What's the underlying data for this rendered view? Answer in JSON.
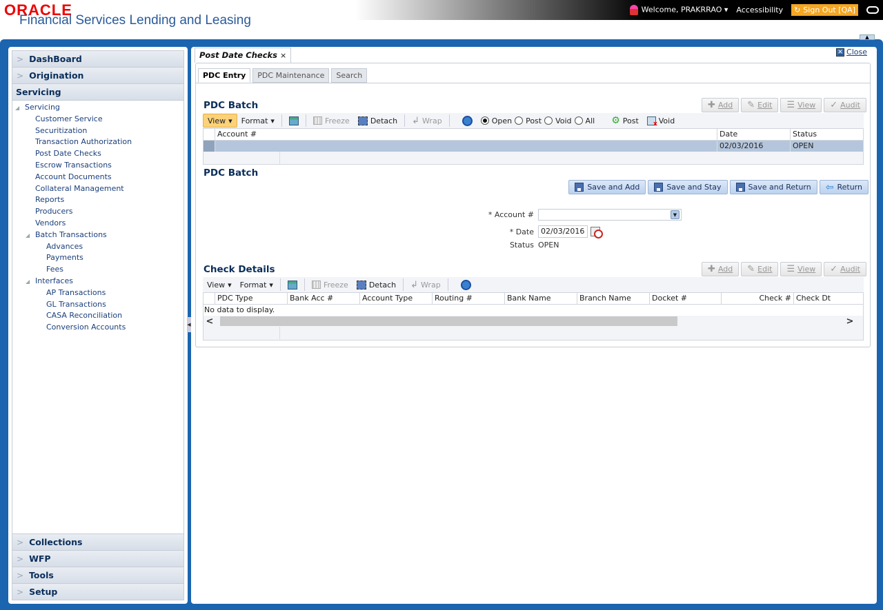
{
  "header": {
    "logo": "ORACLE",
    "app_title": "Financial Services Lending and Leasing",
    "welcome": "Welcome, PRAKRRAO",
    "accessibility": "Accessibility",
    "signout": "Sign Out [QA]"
  },
  "sidebar": {
    "top_sections": [
      {
        "label": "DashBoard"
      },
      {
        "label": "Origination"
      },
      {
        "label": "Servicing"
      }
    ],
    "tree": [
      {
        "label": "Servicing",
        "level": 0,
        "expanded": true
      },
      {
        "label": "Customer Service",
        "level": 1
      },
      {
        "label": "Securitization",
        "level": 1
      },
      {
        "label": "Transaction Authorization",
        "level": 1
      },
      {
        "label": "Post Date Checks",
        "level": 1
      },
      {
        "label": "Escrow Transactions",
        "level": 1
      },
      {
        "label": "Account Documents",
        "level": 1
      },
      {
        "label": "Collateral Management",
        "level": 1
      },
      {
        "label": "Reports",
        "level": 1
      },
      {
        "label": "Producers",
        "level": 1
      },
      {
        "label": "Vendors",
        "level": 1
      },
      {
        "label": "Batch Transactions",
        "level": 1,
        "expanded": true
      },
      {
        "label": "Advances",
        "level": 2
      },
      {
        "label": "Payments",
        "level": 2
      },
      {
        "label": "Fees",
        "level": 2
      },
      {
        "label": "Interfaces",
        "level": 1,
        "expanded": true
      },
      {
        "label": "AP Transactions",
        "level": 2
      },
      {
        "label": "GL Transactions",
        "level": 2
      },
      {
        "label": "CASA Reconciliation",
        "level": 2
      },
      {
        "label": "Conversion Accounts",
        "level": 2
      }
    ],
    "bottom_sections": [
      {
        "label": "Collections"
      },
      {
        "label": "WFP"
      },
      {
        "label": "Tools"
      },
      {
        "label": "Setup"
      }
    ]
  },
  "main": {
    "doc_tab": "Post Date Checks",
    "close_label": "Close",
    "subtabs": [
      {
        "label": "PDC Entry",
        "active": true
      },
      {
        "label": "PDC Maintenance",
        "active": false
      },
      {
        "label": "Search",
        "active": false
      }
    ],
    "batch_grid": {
      "title": "PDC Batch",
      "actions": [
        "Add",
        "Edit",
        "View",
        "Audit"
      ],
      "toolbar": {
        "view": "View",
        "format": "Format",
        "freeze": "Freeze",
        "detach": "Detach",
        "wrap": "Wrap",
        "radios": [
          {
            "label": "Open",
            "checked": true
          },
          {
            "label": "Post",
            "checked": false
          },
          {
            "label": "Void",
            "checked": false
          },
          {
            "label": "All",
            "checked": false
          }
        ],
        "post": "Post",
        "void": "Void"
      },
      "columns": [
        "Account #",
        "Date",
        "Status"
      ],
      "rows": [
        {
          "account": "",
          "date": "02/03/2016",
          "status": "OPEN"
        }
      ]
    },
    "batch_form": {
      "title": "PDC Batch",
      "buttons": [
        "Save and Add",
        "Save and Stay",
        "Save and Return",
        "Return"
      ],
      "account_label": "* Account #",
      "account_value": "",
      "date_label": "* Date",
      "date_value": "02/03/2016",
      "status_label": "Status",
      "status_value": "OPEN"
    },
    "check_details": {
      "title": "Check Details",
      "actions": [
        "Add",
        "Edit",
        "View",
        "Audit"
      ],
      "toolbar": {
        "view": "View",
        "format": "Format",
        "freeze": "Freeze",
        "detach": "Detach",
        "wrap": "Wrap"
      },
      "columns": [
        "PDC Type",
        "Bank Acc #",
        "Account Type",
        "Routing #",
        "Bank Name",
        "Branch Name",
        "Docket #",
        "Check #",
        "Check Dt"
      ],
      "empty_text": "No data to display."
    }
  }
}
